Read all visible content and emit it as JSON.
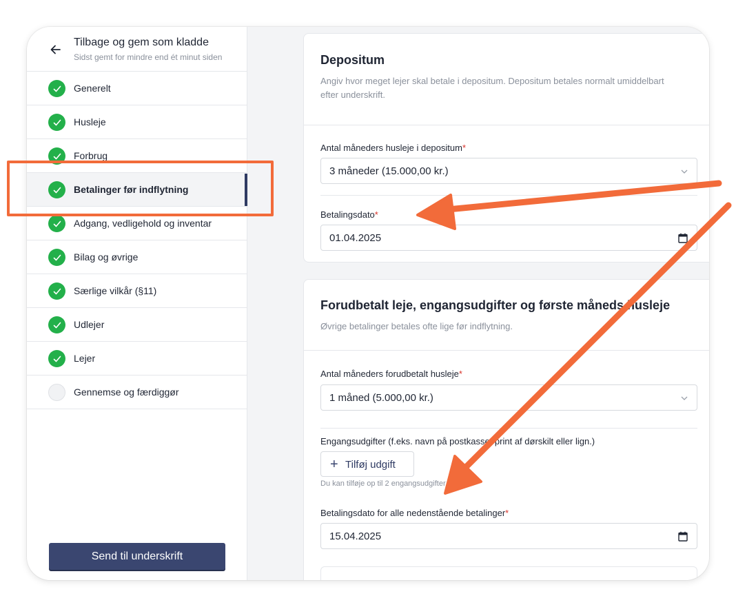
{
  "sidebar": {
    "back_title": "Tilbage og gem som kladde",
    "saved_status": "Sidst gemt for mindre end ét minut siden",
    "items": [
      {
        "label": "Generelt",
        "status": "done"
      },
      {
        "label": "Husleje",
        "status": "done"
      },
      {
        "label": "Forbrug",
        "status": "done"
      },
      {
        "label": "Betalinger før indflytning",
        "status": "done"
      },
      {
        "label": "Adgang, vedligehold og inventar",
        "status": "done"
      },
      {
        "label": "Bilag og øvrige",
        "status": "done"
      },
      {
        "label": "Særlige vilkår (§11)",
        "status": "done"
      },
      {
        "label": "Udlejer",
        "status": "done"
      },
      {
        "label": "Lejer",
        "status": "done"
      },
      {
        "label": "Gennemse og færdiggør",
        "status": "pending"
      }
    ],
    "active_index": 3,
    "send_button": "Send til underskrift"
  },
  "deposit": {
    "title": "Depositum",
    "description": "Angiv hvor meget lejer skal betale i depositum. Depositum betales normalt umiddelbart efter underskrift.",
    "months_label": "Antal måneders husleje i depositum",
    "months_value": "3 måneder (15.000,00 kr.)",
    "date_label": "Betalingsdato",
    "date_value": "01.04.2025"
  },
  "prepaid": {
    "title": "Forudbetalt leje, engangsudgifter og første måneds husleje",
    "description": "Øvrige betalinger betales ofte lige før indflytning.",
    "months_label": "Antal måneders forudbetalt husleje",
    "months_value": "1 måned (5.000,00 kr.)",
    "one_time_label": "Engangsudgifter (f.eks. navn på postkasse, print af dørskilt eller lign.)",
    "add_button": "Tilføj udgift",
    "add_hint": "Du kan tilføje op til 2 engangsudgifter",
    "date_label": "Betalingsdato for alle nedenstående betalinger",
    "date_value": "15.04.2025"
  },
  "required_mark": "*",
  "colors": {
    "accent": "#3a4670",
    "success": "#23b04a",
    "annotation": "#f26b3a",
    "required": "#d9342b"
  },
  "icons": {
    "back": "arrow-left-icon",
    "done": "check-circle-icon",
    "pending": "empty-circle-icon",
    "select": "chevron-down-icon",
    "date": "calendar-icon",
    "add": "plus-icon"
  }
}
